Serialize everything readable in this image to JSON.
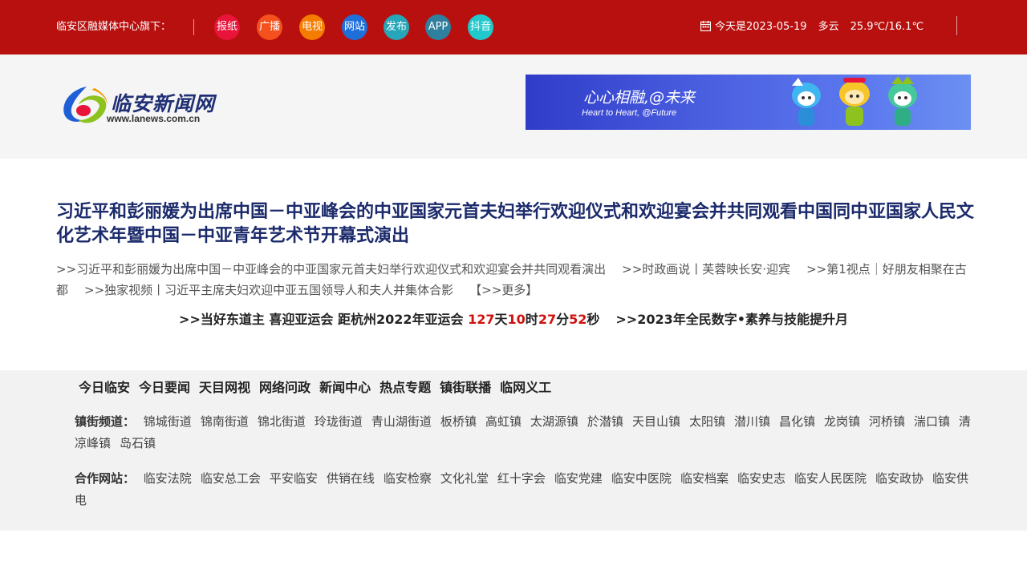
{
  "topbar": {
    "label": "临安区融媒体中心旗下：",
    "media_buttons": [
      {
        "label": "报纸",
        "color": "#e8143a"
      },
      {
        "label": "广播",
        "color": "#f4511e"
      },
      {
        "label": "电视",
        "color": "#f57c00"
      },
      {
        "label": "网站",
        "color": "#1e6fd9"
      },
      {
        "label": "发布",
        "color": "#26a6b8"
      },
      {
        "label": "APP",
        "color": "#2f7f9e"
      },
      {
        "label": "抖音",
        "color": "#22c9cc"
      }
    ],
    "date_text": "今天是2023-05-19",
    "weather": "多云",
    "temperature": "25.9℃/16.1℃"
  },
  "header": {
    "logo_title": "临安新闻网",
    "logo_url": "www.lanews.com.cn",
    "banner_main": "心心相融,@未来",
    "banner_sub": "Heart to Heart, @Future"
  },
  "headline": "习近平和彭丽媛为出席中国－中亚峰会的中亚国家元首夫妇举行欢迎仪式和欢迎宴会并共同观看中国同中亚国家人民文化艺术年暨中国－中亚青年艺术节开幕式演出",
  "sublinks": [
    ">>习近平和彭丽媛为出席中国－中亚峰会的中亚国家元首夫妇举行欢迎仪式和欢迎宴会并共同观看演出",
    ">>时政画说丨芙蓉映长安·迎宾",
    ">>第1视点｜好朋友相聚在古都",
    ">>独家视频丨习近平主席夫妇欢迎中亚五国领导人和夫人并集体合影"
  ],
  "more_label": "【>>更多】",
  "countdown": {
    "prefix": ">>当好东道主 喜迎亚运会 距杭州2022年亚运会 ",
    "days": "127",
    "days_unit": "天",
    "hours": "10",
    "hours_unit": "时",
    "minutes": "27",
    "minutes_unit": "分",
    "seconds": "52",
    "seconds_unit": "秒",
    "second_link": ">>2023年全民数字•素养与技能提升月"
  },
  "mainnav": [
    "今日临安",
    "今日要闻",
    "天目网视",
    "网络问政",
    "新闻中心",
    "热点专题",
    "镇街联播",
    "临网义工"
  ],
  "towns": {
    "label": "镇街频道：",
    "items": [
      "锦城街道",
      "锦南街道",
      "锦北街道",
      "玲珑街道",
      "青山湖街道",
      "板桥镇",
      "高虹镇",
      "太湖源镇",
      "於潜镇",
      "天目山镇",
      "太阳镇",
      "潜川镇",
      "昌化镇",
      "龙岗镇",
      "河桥镇",
      "湍口镇",
      "清凉峰镇",
      "岛石镇"
    ]
  },
  "partners": {
    "label": "合作网站：",
    "items": [
      "临安法院",
      "临安总工会",
      "平安临安",
      "供销在线",
      "临安检察",
      "文化礼堂",
      "红十字会",
      "临安党建",
      "临安中医院",
      "临安档案",
      "临安史志",
      "临安人民医院",
      "临安政协",
      "临安供电"
    ]
  }
}
